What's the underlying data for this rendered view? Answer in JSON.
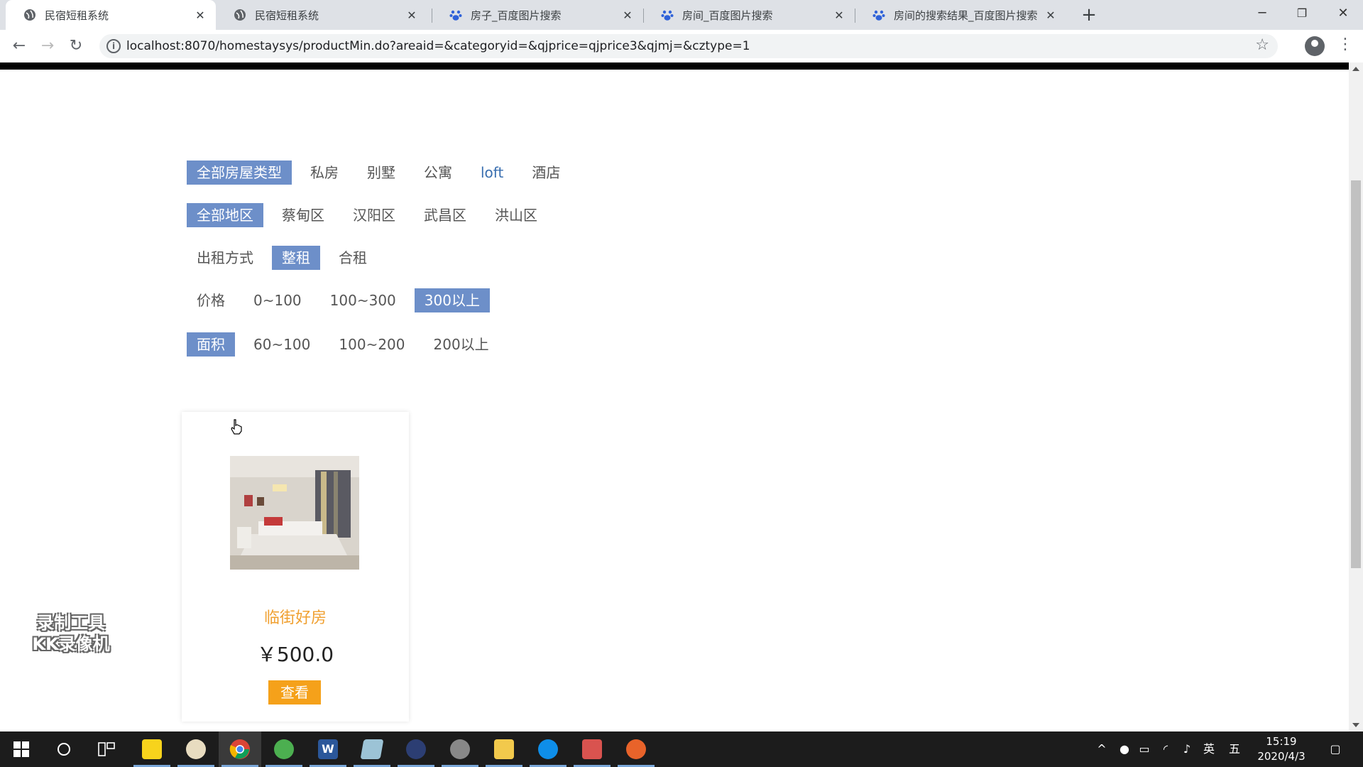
{
  "browser": {
    "tabs": [
      {
        "title": "民宿短租系统",
        "active": true,
        "icon": "globe-icon"
      },
      {
        "title": "民宿短租系统",
        "active": false,
        "icon": "globe-icon"
      },
      {
        "title": "房子_百度图片搜索",
        "active": false,
        "icon": "baidu-paw-icon"
      },
      {
        "title": "房间_百度图片搜索",
        "active": false,
        "icon": "baidu-paw-icon"
      },
      {
        "title": "房间的搜索结果_百度图片搜索",
        "active": false,
        "icon": "baidu-paw-icon"
      }
    ],
    "url": "localhost:8070/homestaysys/productMin.do?areaid=&categoryid=&qjprice=qjprice3&qjmj=&cztype=1"
  },
  "filters": {
    "category": {
      "items": [
        "全部房屋类型",
        "私房",
        "别墅",
        "公寓",
        "loft",
        "酒店"
      ],
      "active_index": 0
    },
    "area": {
      "items": [
        "全部地区",
        "蔡甸区",
        "汉阳区",
        "武昌区",
        "洪山区"
      ],
      "active_index": 0
    },
    "rent_type": {
      "label": "出租方式",
      "items": [
        "整租",
        "合租"
      ],
      "active_index": 0
    },
    "price": {
      "label": "价格",
      "items": [
        "0~100",
        "100~300",
        "300以上"
      ],
      "active_index": 2
    },
    "size": {
      "label": "面积",
      "items": [
        "60~100",
        "100~200",
        "200以上"
      ],
      "label_active": true
    }
  },
  "products": [
    {
      "name": "临街好房",
      "price": "￥500.0",
      "button": "查看"
    }
  ],
  "watermark": [
    "录制工具",
    "KK录像机"
  ],
  "taskbar": {
    "time": "15:19",
    "date": "2020/4/3",
    "ime_lang": "英",
    "ime_mode": "五"
  },
  "colors": {
    "filter_active": "#6d8fc9",
    "product_name": "#f0a030",
    "view_button": "#f5a11a"
  }
}
